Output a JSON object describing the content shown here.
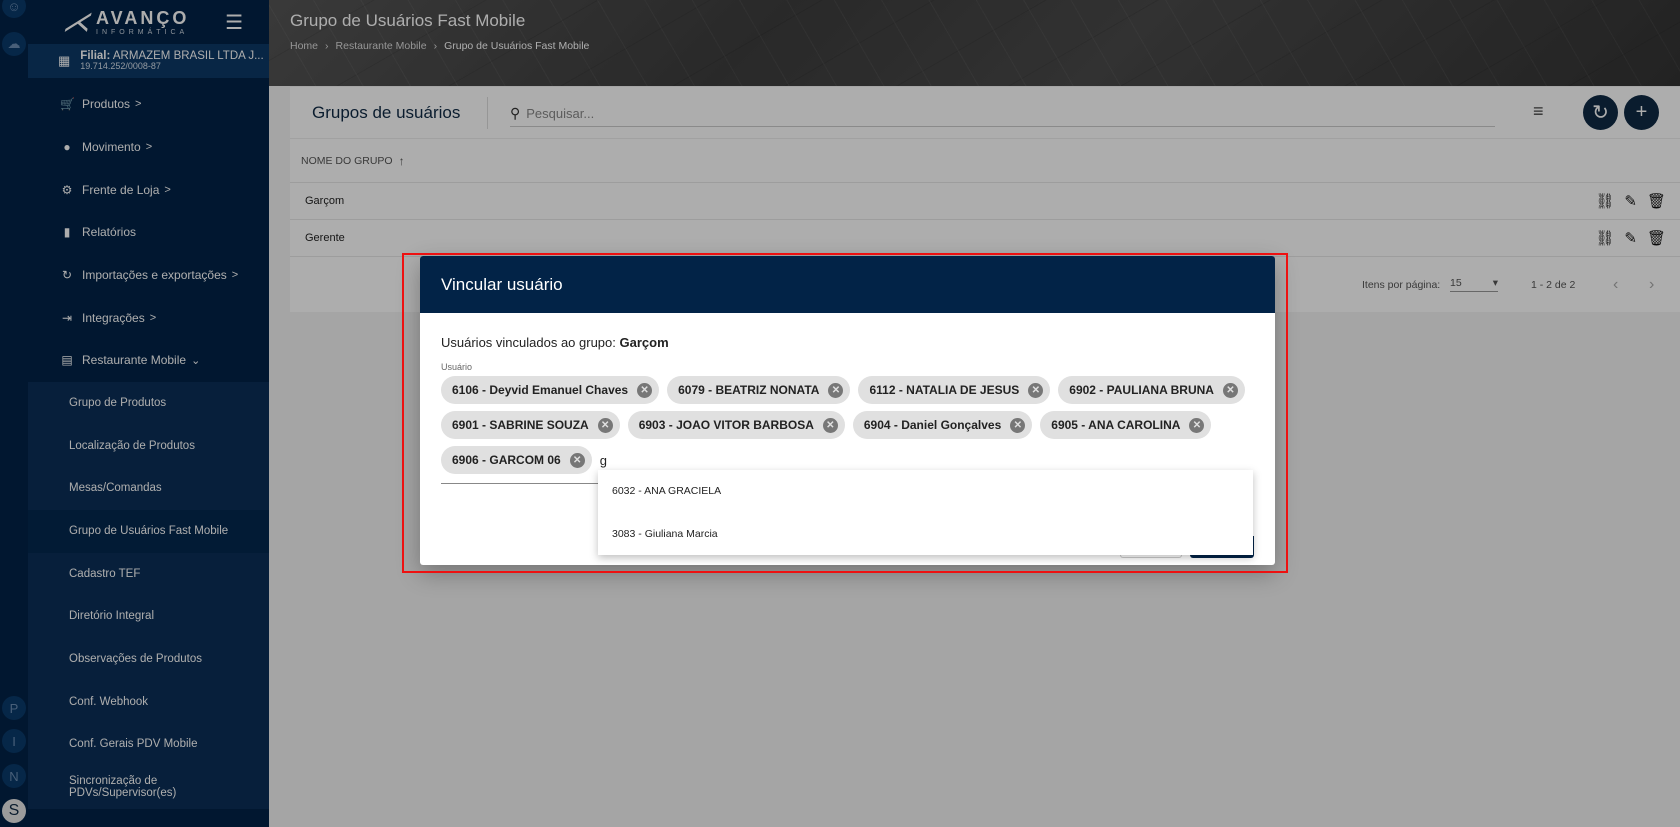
{
  "rail": {
    "letters": [
      "P",
      "I",
      "N",
      "S"
    ]
  },
  "sidebar": {
    "logo_text": "AVANÇO",
    "logo_subtext": "INFORMÁTICA",
    "filial_label": "Filial:",
    "filial_name": "ARMAZEM BRASIL LTDA J...",
    "filial_cnpj": "19.714.252/0008-87",
    "items": [
      {
        "label": "Produtos",
        "chevron": ">"
      },
      {
        "label": "Movimento",
        "chevron": ">"
      },
      {
        "label": "Frente de Loja",
        "chevron": ">"
      },
      {
        "label": "Relatórios",
        "chevron": ""
      },
      {
        "label": "Importações e exportações",
        "chevron": ">"
      },
      {
        "label": "Integrações",
        "chevron": ">"
      },
      {
        "label": "Restaurante Mobile",
        "chevron": "⌄"
      }
    ],
    "subitems": [
      "Grupo de Produtos",
      "Localização de Produtos",
      "Mesas/Comandas",
      "Grupo de Usuários Fast Mobile",
      "Cadastro TEF",
      "Diretório Integral",
      "Observações de Produtos",
      "Conf. Webhook",
      "Conf. Gerais PDV Mobile",
      "Sincronização de PDVs/Supervisor(es)"
    ],
    "active_subitem": "Grupo de Usuários Fast Mobile"
  },
  "header": {
    "title": "Grupo de Usuários Fast Mobile",
    "breadcrumbs": [
      "Home",
      "Restaurante Mobile",
      "Grupo de Usuários Fast Mobile"
    ]
  },
  "main": {
    "card_title": "Grupos de usuários",
    "search_placeholder": "Pesquisar...",
    "column_header": "NOME DO GRUPO",
    "rows": [
      "Garçom",
      "Gerente"
    ],
    "pager": {
      "items_per_page_label": "Itens por página:",
      "items_per_page_value": "15",
      "range": "1 - 2 de 2"
    }
  },
  "dialog": {
    "title": "Vincular usuário",
    "linked_label": "Usuários vinculados ao grupo:",
    "group_name": "Garçom",
    "field_label": "Usuário",
    "chips": [
      "6106 - Deyvid Emanuel Chaves",
      "6079 - BEATRIZ NONATA",
      "6112 - NATALIA DE JESUS",
      "6902 - PAULIANA BRUNA",
      "6901 - SABRINE SOUZA",
      "6903 - JOAO VITOR BARBOSA",
      "6904 - Daniel Gonçalves",
      "6905 - ANA CAROLINA",
      "6906 - GARCOM 06"
    ],
    "input_value": "g",
    "autocomplete_options": [
      "6032 - ANA GRACIELA",
      "3083 - Giuliana Marcia"
    ]
  },
  "colors": {
    "navy": "#022347",
    "highlight": "#e11111"
  }
}
